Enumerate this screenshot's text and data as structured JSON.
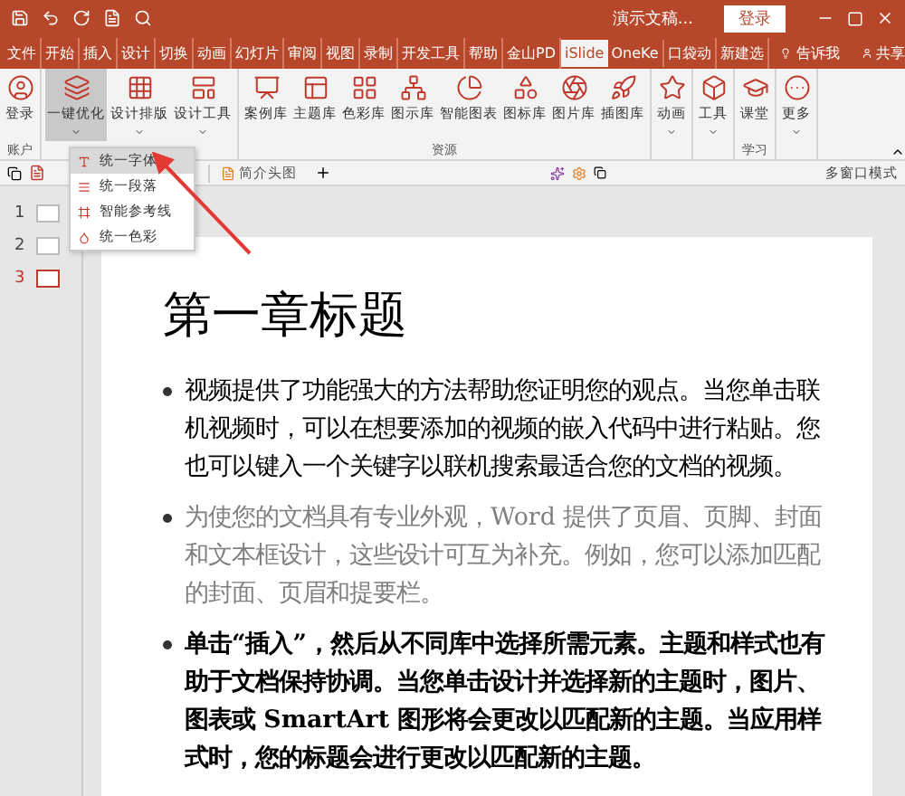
{
  "window": {
    "title": "演示文稿...",
    "login_button": "登录"
  },
  "menu_tabs": [
    {
      "label": "文件",
      "selected": false
    },
    {
      "label": "开始",
      "selected": false
    },
    {
      "label": "插入",
      "selected": false
    },
    {
      "label": "设计",
      "selected": false
    },
    {
      "label": "切换",
      "selected": false
    },
    {
      "label": "动画",
      "selected": false
    },
    {
      "label": "幻灯片",
      "selected": false
    },
    {
      "label": "审阅",
      "selected": false
    },
    {
      "label": "视图",
      "selected": false
    },
    {
      "label": "录制",
      "selected": false
    },
    {
      "label": "开发工具",
      "selected": false
    },
    {
      "label": "帮助",
      "selected": false
    },
    {
      "label": "金山PD",
      "selected": false
    },
    {
      "label": "iSlide",
      "selected": true
    },
    {
      "label": "OneKe",
      "selected": false
    },
    {
      "label": "口袋动",
      "selected": false
    },
    {
      "label": "新建选",
      "selected": false
    }
  ],
  "tell_me": "告诉我",
  "share": "共享",
  "ribbon_groups": [
    {
      "label": "账户",
      "buttons": [
        {
          "label": "登录",
          "dropdown": false,
          "pressed": false
        }
      ]
    },
    {
      "buttons": [
        {
          "label": "一键优化",
          "dropdown": true,
          "pressed": true
        },
        {
          "label": "设计排版",
          "dropdown": true,
          "pressed": false
        },
        {
          "label": "设计工具",
          "dropdown": true,
          "pressed": false
        }
      ]
    },
    {
      "label": "资源",
      "buttons": [
        {
          "label": "案例库",
          "dropdown": false,
          "pressed": false
        },
        {
          "label": "主题库",
          "dropdown": false,
          "pressed": false
        },
        {
          "label": "色彩库",
          "dropdown": false,
          "pressed": false
        },
        {
          "label": "图示库",
          "dropdown": false,
          "pressed": false
        },
        {
          "label": "智能图表",
          "dropdown": false,
          "pressed": false
        },
        {
          "label": "图标库",
          "dropdown": false,
          "pressed": false
        },
        {
          "label": "图片库",
          "dropdown": false,
          "pressed": false
        },
        {
          "label": "插图库",
          "dropdown": false,
          "pressed": false
        }
      ]
    },
    {
      "buttons": [
        {
          "label": "动画",
          "dropdown": true,
          "pressed": false
        }
      ]
    },
    {
      "buttons": [
        {
          "label": "工具",
          "dropdown": true,
          "pressed": false
        }
      ]
    },
    {
      "label": "学习",
      "buttons": [
        {
          "label": "课堂",
          "dropdown": false,
          "pressed": false
        }
      ]
    },
    {
      "buttons": [
        {
          "label": "更多",
          "dropdown": true,
          "pressed": false
        }
      ]
    }
  ],
  "doc_tabs": [
    {
      "label": "简介头图"
    }
  ],
  "multi_window": "多窗口模式",
  "dropdown_menu": [
    {
      "label": "统一字体",
      "selected": true
    },
    {
      "label": "统一段落",
      "selected": false
    },
    {
      "label": "智能参考线",
      "selected": false
    },
    {
      "label": "统一色彩",
      "selected": false
    }
  ],
  "thumbnails": [
    {
      "number": "1",
      "selected": false
    },
    {
      "number": "2",
      "selected": false
    },
    {
      "number": "3",
      "selected": true
    }
  ],
  "slide": {
    "title": "第一章标题",
    "bullets": [
      {
        "kind": "normal",
        "text": "视频提供了功能强大的方法帮助您证明您的观点。当您单击联机视频时，可以在想要添加的视频的嵌入代码中进行粘贴。您也可以键入一个关键字以联机搜索最适合您的文档的视频。"
      },
      {
        "kind": "muted",
        "text": "为使您的文档具有专业外观，Word 提供了页眉、页脚、封面和文本框设计，这些设计可互为补充。例如，您可以添加匹配的封面、页眉和提要栏。"
      },
      {
        "kind": "bold",
        "text": "单击“插入”，然后从不同库中选择所需元素。主题和样式也有助于文档保持协调。当您单击设计并选择新的主题时，图片、图表或 SmartArt 图形将会更改以匹配新的主题。当应用样式时，您的标题会进行更改以匹配新的主题。"
      }
    ]
  }
}
